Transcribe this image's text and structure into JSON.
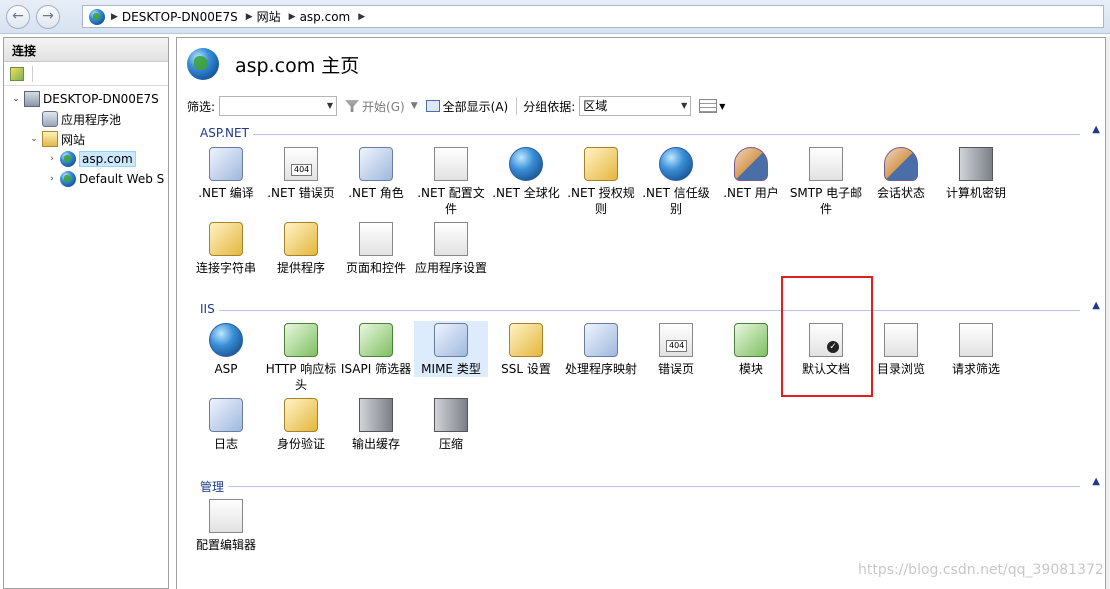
{
  "address_bar": {
    "segments": [
      "DESKTOP-DN00E7S",
      "网站",
      "asp.com"
    ],
    "back_glyph": "←",
    "forward_glyph": "→"
  },
  "left_pane": {
    "header": "连接",
    "tree": [
      {
        "label": "DESKTOP-DN00E7S",
        "icon": "server-icon"
      },
      {
        "label": "应用程序池",
        "icon": "app-pool-icon"
      },
      {
        "label": "网站",
        "icon": "sites-icon"
      },
      {
        "label": "asp.com",
        "icon": "globe-icon",
        "selected": true
      },
      {
        "label": "Default Web S",
        "icon": "globe-icon"
      }
    ]
  },
  "main": {
    "title": "asp.com 主页",
    "filter": {
      "label": "筛选:",
      "value": "",
      "start_label": "开始(G)",
      "show_all_label": "全部显示(A)",
      "group_by_label": "分组依据:",
      "group_by_value": "区域"
    },
    "sections": [
      {
        "title": "ASP.NET",
        "items": [
          {
            "label": ".NET 编译",
            "icon": "net-compilation-icon"
          },
          {
            "label": ".NET 错误页",
            "icon": "net-error-pages-icon"
          },
          {
            "label": ".NET 角色",
            "icon": "net-roles-icon"
          },
          {
            "label": ".NET 配置文件",
            "icon": "net-profile-icon"
          },
          {
            "label": ".NET 全球化",
            "icon": "net-globalization-icon"
          },
          {
            "label": ".NET 授权规则",
            "icon": "net-authorization-icon"
          },
          {
            "label": ".NET 信任级别",
            "icon": "net-trust-levels-icon"
          },
          {
            "label": ".NET 用户",
            "icon": "net-users-icon"
          },
          {
            "label": "SMTP 电子邮件",
            "icon": "smtp-email-icon"
          },
          {
            "label": "会话状态",
            "icon": "session-state-icon"
          },
          {
            "label": "计算机密钥",
            "icon": "machine-key-icon"
          },
          {
            "label": "连接字符串",
            "icon": "connection-strings-icon"
          },
          {
            "label": "提供程序",
            "icon": "providers-icon"
          },
          {
            "label": "页面和控件",
            "icon": "pages-controls-icon"
          },
          {
            "label": "应用程序设置",
            "icon": "app-settings-icon"
          }
        ]
      },
      {
        "title": "IIS",
        "items": [
          {
            "label": "ASP",
            "icon": "asp-icon"
          },
          {
            "label": "HTTP 响应标头",
            "icon": "http-headers-icon"
          },
          {
            "label": "ISAPI 筛选器",
            "icon": "isapi-filters-icon"
          },
          {
            "label": "MIME 类型",
            "icon": "mime-types-icon",
            "selected": true
          },
          {
            "label": "SSL 设置",
            "icon": "ssl-settings-icon"
          },
          {
            "label": "处理程序映射",
            "icon": "handler-mappings-icon"
          },
          {
            "label": "错误页",
            "icon": "error-pages-icon"
          },
          {
            "label": "模块",
            "icon": "modules-icon"
          },
          {
            "label": "默认文档",
            "icon": "default-document-icon"
          },
          {
            "label": "目录浏览",
            "icon": "directory-browsing-icon"
          },
          {
            "label": "请求筛选",
            "icon": "request-filtering-icon"
          },
          {
            "label": "日志",
            "icon": "logging-icon"
          },
          {
            "label": "身份验证",
            "icon": "authentication-icon"
          },
          {
            "label": "输出缓存",
            "icon": "output-caching-icon"
          },
          {
            "label": "压缩",
            "icon": "compression-icon"
          }
        ]
      },
      {
        "title": "管理",
        "items": [
          {
            "label": "配置编辑器",
            "icon": "configuration-editor-icon"
          }
        ]
      }
    ]
  },
  "watermark": "https://blog.csdn.net/qq_39081372"
}
